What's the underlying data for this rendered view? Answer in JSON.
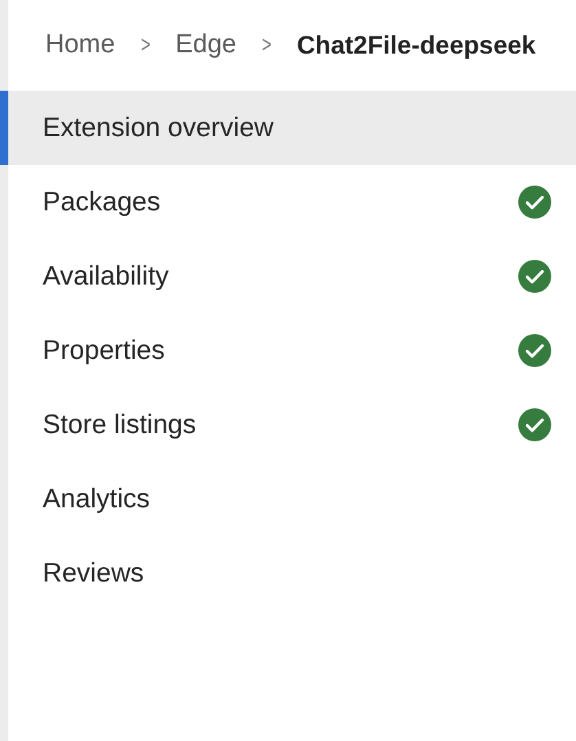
{
  "breadcrumb": [
    {
      "label": "Home",
      "current": false
    },
    {
      "label": "Edge",
      "current": false
    },
    {
      "label": "Chat2File-deepseek",
      "current": true
    }
  ],
  "separator": ">",
  "nav": [
    {
      "label": "Extension overview",
      "selected": true,
      "complete": false
    },
    {
      "label": "Packages",
      "selected": false,
      "complete": true
    },
    {
      "label": "Availability",
      "selected": false,
      "complete": true
    },
    {
      "label": "Properties",
      "selected": false,
      "complete": true
    },
    {
      "label": "Store listings",
      "selected": false,
      "complete": true
    },
    {
      "label": "Analytics",
      "selected": false,
      "complete": false
    },
    {
      "label": "Reviews",
      "selected": false,
      "complete": false
    }
  ]
}
